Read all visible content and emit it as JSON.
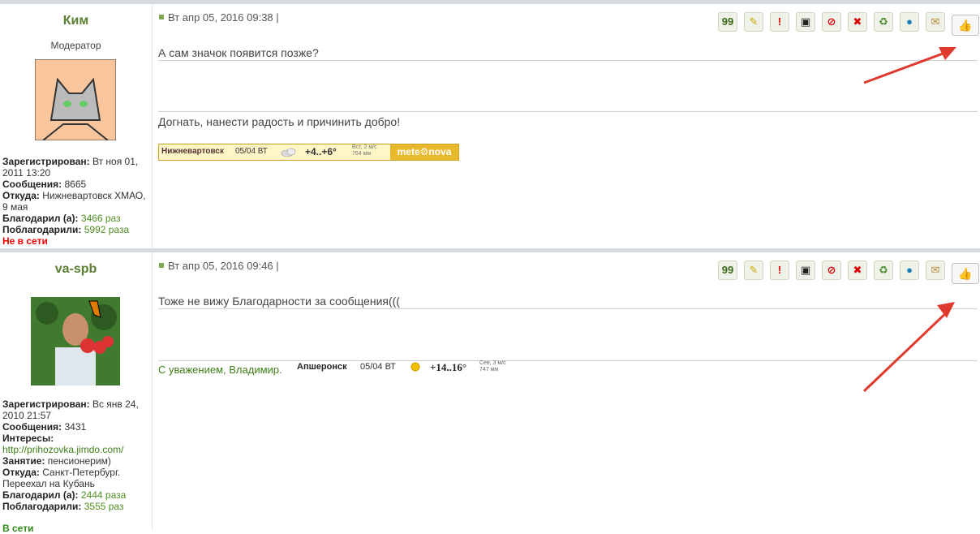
{
  "posts": [
    {
      "author": "Ким",
      "rank": "Модератор",
      "profile": {
        "registered_label": "Зарегистрирован:",
        "registered": " Вт ноя 01, 2011 13:20",
        "posts_label": "Сообщения:",
        "posts": " 8665",
        "from_label": "Откуда:",
        "from": " Нижневартовск ХМАО, 9 мая",
        "thanked_label": "Благодарил (а):",
        "thanked": "3466 раз",
        "thanked_by_label": "Поблагодарили:",
        "thanked_by": "5992 раза",
        "status": "Не в сети"
      },
      "date": "Вт апр 05, 2016 09:38 |",
      "message": "А сам значок появится позже?",
      "signature": "Догнать, нанести радость и причинить добро!",
      "weather": {
        "city": "Нижневартовск",
        "date": "05/04  ВТ",
        "temp": "+4..+6°",
        "wind_1": "Вст, 2 м/с",
        "wind_2": "764 мм",
        "logo": "mete⚙nova"
      }
    },
    {
      "author": "va-spb",
      "profile": {
        "registered_label": "Зарегистрирован:",
        "registered": " Вс янв 24, 2010 21:57",
        "posts_label": "Сообщения:",
        "posts": " 3431",
        "interests_label": "Интересы:",
        "interests": "http://prihozovka.jimdo.com/",
        "occupation_label": "Занятие:",
        "occupation": " пенсионерим)",
        "from_label": "Откуда:",
        "from": " Санкт-Петербург. Переехал на Кубань",
        "thanked_label": "Благодарил (а):",
        "thanked": "2444 раза",
        "thanked_by_label": "Поблагодарили:",
        "thanked_by": "3555 раз",
        "status": "В сети"
      },
      "date": "Вт апр 05, 2016 09:46 |",
      "message": "Тоже не вижу Благодарности за сообщения(((",
      "signature": "С уважением, Владимир.",
      "weather": {
        "city": "Апшеронск",
        "date": "05/04  ВТ",
        "temp": "+14..16°",
        "wind_1": "Сев, 3 м/с",
        "wind_2": "747 мм"
      }
    }
  ],
  "toolbar_icons": [
    "quote-icon",
    "edit-icon",
    "report-icon",
    "info-icon",
    "warn-icon",
    "delete-icon",
    "karma-icon",
    "chat-icon",
    "pm-icon"
  ],
  "toolbar_glyphs": [
    "99",
    "✎",
    "!",
    "▣",
    "⊘",
    "✖",
    "♻",
    "●",
    "✉"
  ],
  "like_glyph": "👍",
  "colors": {
    "accent": "#5a7f33",
    "offline": "#e00000",
    "online": "#2f8a1b",
    "arrow": "#e03a2e"
  }
}
